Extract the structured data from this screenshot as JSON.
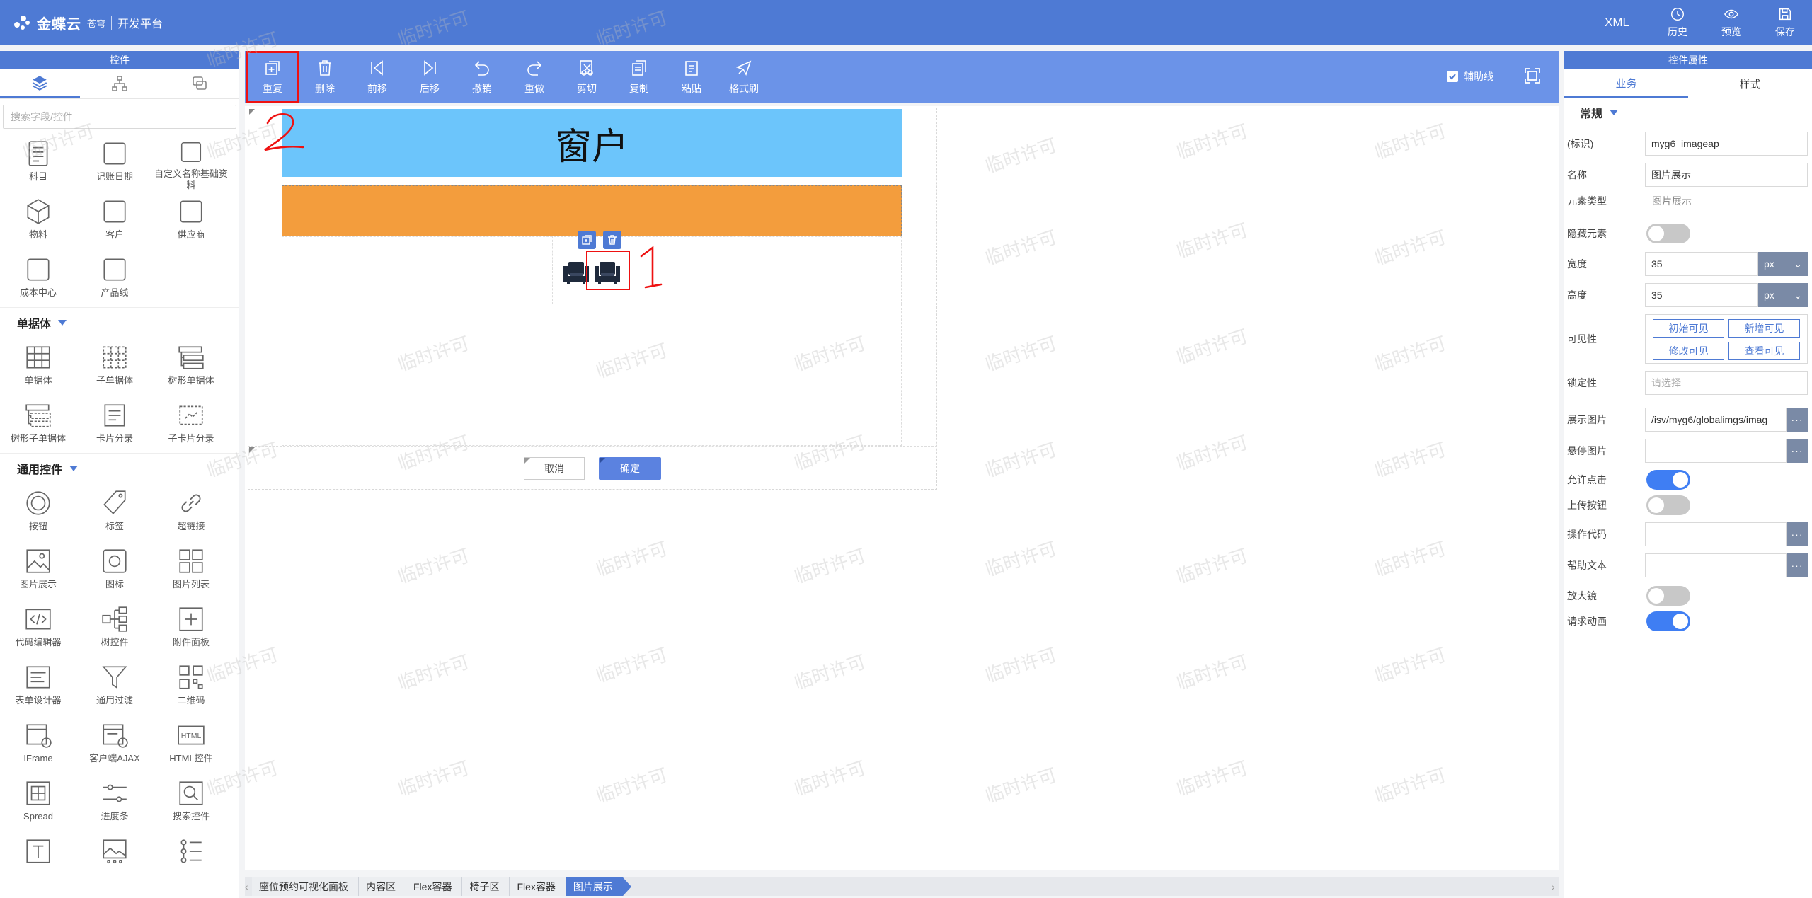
{
  "topbar": {
    "brand": "金蝶云",
    "brand_sub": "苍穹",
    "platform": "开发平台",
    "xml": "XML",
    "actions": [
      {
        "label": "历史",
        "icon": "history-icon"
      },
      {
        "label": "预览",
        "icon": "eye-icon"
      },
      {
        "label": "保存",
        "icon": "save-icon"
      }
    ]
  },
  "left_panel": {
    "title": "控件",
    "tabs": [
      "layers-icon",
      "tree-icon",
      "copy-icon"
    ],
    "search_placeholder": "搜索字段/控件",
    "basic_items": [
      "科目",
      "记账日期",
      "自定义名称基础资料",
      "物料",
      "客户",
      "供应商",
      "成本中心",
      "产品线"
    ],
    "section_entry": "单据体",
    "entry_items": [
      "单据体",
      "子单据体",
      "树形单据体",
      "树形子单据体",
      "卡片分录",
      "子卡片分录"
    ],
    "section_common": "通用控件",
    "common_items": [
      "按钮",
      "标签",
      "超链接",
      "图片展示",
      "图标",
      "图片列表",
      "代码编辑器",
      "树控件",
      "附件面板",
      "表单设计器",
      "通用过滤",
      "二维码",
      "IFrame",
      "客户端AJAX",
      "HTML控件",
      "Spread",
      "进度条",
      "搜索控件"
    ]
  },
  "toolbar": {
    "items": [
      "重复",
      "删除",
      "前移",
      "后移",
      "撤销",
      "重做",
      "剪切",
      "复制",
      "粘贴",
      "格式刷"
    ],
    "aux_label": "辅助线"
  },
  "canvas": {
    "header_title": "窗户",
    "cancel": "取消",
    "ok": "确定",
    "annotation_1": "1",
    "annotation_2": "2",
    "watermark": "临时许可"
  },
  "breadcrumb": [
    "座位预约可视化面板",
    "内容区",
    "Flex容器",
    "椅子区",
    "Flex容器",
    "图片展示"
  ],
  "right_panel": {
    "title": "控件属性",
    "tabs": [
      "业务",
      "样式"
    ],
    "group": "常规",
    "props": {
      "id_label": "(标识)",
      "id_value": "myg6_imageap",
      "name_label": "名称",
      "name_value": "图片展示",
      "type_label": "元素类型",
      "type_value": "图片展示",
      "hidden_label": "隐藏元素",
      "width_label": "宽度",
      "width_value": "35",
      "width_unit": "px",
      "height_label": "高度",
      "height_value": "35",
      "height_unit": "px",
      "visible_label": "可见性",
      "visible_chips": [
        "初始可见",
        "新增可见",
        "修改可见",
        "查看可见"
      ],
      "lock_label": "锁定性",
      "lock_placeholder": "请选择",
      "image_label": "展示图片",
      "image_value": "/isv/myg6/globalimgs/imag",
      "hover_label": "悬停图片",
      "click_label": "允许点击",
      "upload_label": "上传按钮",
      "opcode_label": "操作代码",
      "help_label": "帮助文本",
      "magnifier_label": "放大镜",
      "anim_label": "请求动画",
      "more": "···"
    },
    "toggles": {
      "hidden": false,
      "click": true,
      "upload": false,
      "magnifier": false,
      "anim": true
    }
  },
  "colors": {
    "brand": "#4e7ad4",
    "toolbar": "#6b93e8",
    "header_block": "#6cc5fb",
    "orange_block": "#f39d3d",
    "annotation": "#e11111"
  }
}
